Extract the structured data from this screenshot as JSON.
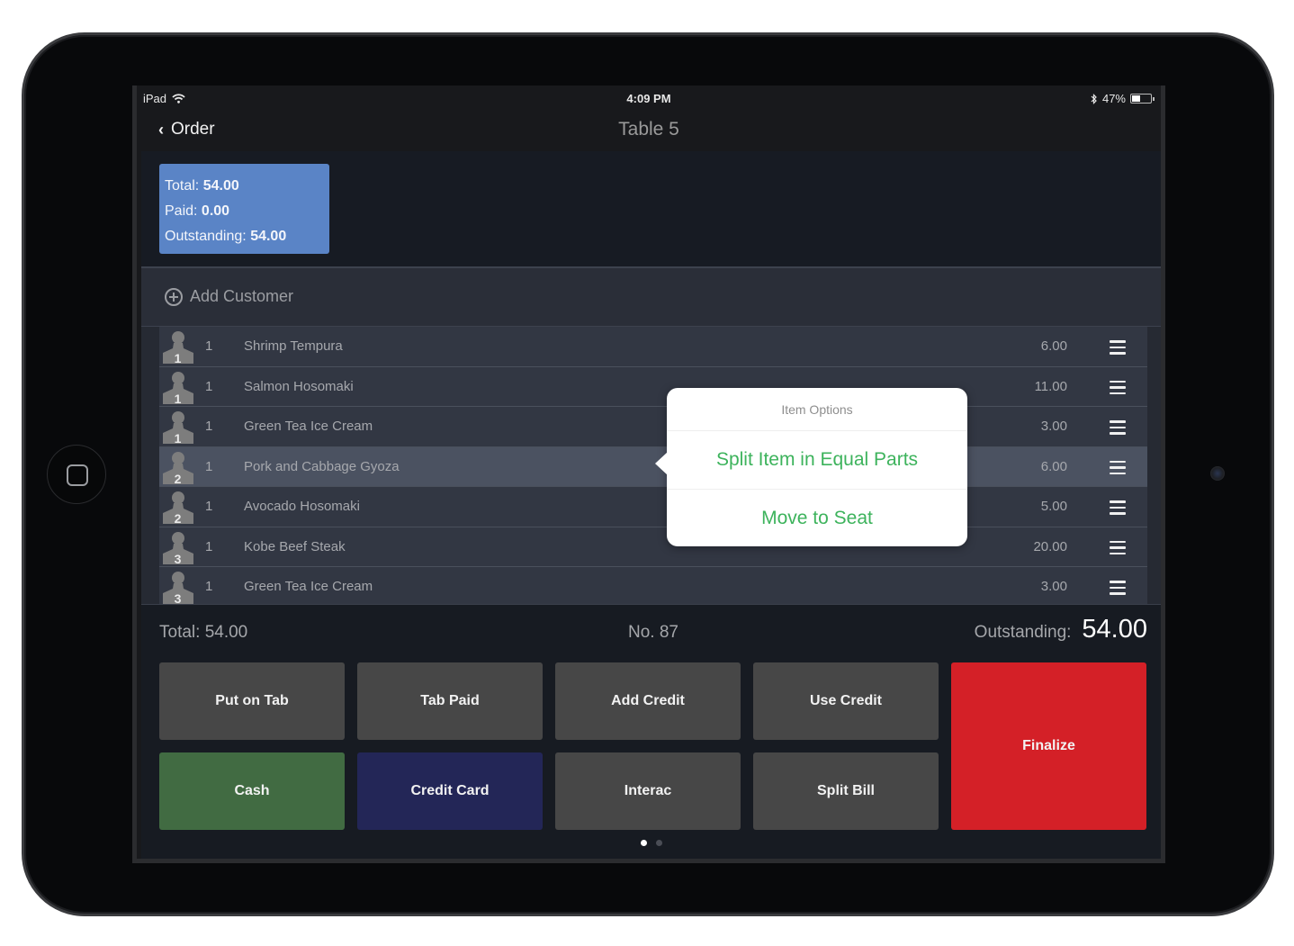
{
  "status_bar": {
    "device": "iPad",
    "time": "4:09 PM",
    "battery_percent": "47%",
    "battery_level": 0.47
  },
  "nav": {
    "back_label": "Order",
    "title": "Table 5"
  },
  "summary": {
    "total_label": "Total:",
    "total_value": "54.00",
    "paid_label": "Paid:",
    "paid_value": "0.00",
    "outstanding_label": "Outstanding:",
    "outstanding_value": "54.00",
    "color": "#5a84c6"
  },
  "add_customer_label": "Add Customer",
  "items": [
    {
      "seat": "1",
      "qty": "1",
      "name": "Shrimp Tempura",
      "price": "6.00"
    },
    {
      "seat": "1",
      "qty": "1",
      "name": "Salmon Hosomaki",
      "price": "11.00"
    },
    {
      "seat": "1",
      "qty": "1",
      "name": "Green Tea Ice Cream",
      "price": "3.00"
    },
    {
      "seat": "2",
      "qty": "1",
      "name": "Pork and Cabbage Gyoza",
      "price": "6.00",
      "selected": true
    },
    {
      "seat": "2",
      "qty": "1",
      "name": "Avocado Hosomaki",
      "price": "5.00"
    },
    {
      "seat": "3",
      "qty": "1",
      "name": "Kobe Beef Steak",
      "price": "20.00"
    },
    {
      "seat": "3",
      "qty": "1",
      "name": "Green Tea Ice Cream",
      "price": "3.00"
    }
  ],
  "popover": {
    "title": "Item Options",
    "options": [
      "Split Item in Equal Parts",
      "Move to Seat"
    ],
    "accent": "#3db35c"
  },
  "totals": {
    "total": "Total: 54.00",
    "order_number": "No. 87",
    "outstanding_label": "Outstanding:",
    "outstanding_value": "54.00"
  },
  "actions": [
    {
      "label": "Put on Tab",
      "color": "#474747"
    },
    {
      "label": "Tab Paid",
      "color": "#474747"
    },
    {
      "label": "Add Credit",
      "color": "#474747"
    },
    {
      "label": "Use Credit",
      "color": "#474747"
    },
    {
      "label": "Cash",
      "color": "#416b42"
    },
    {
      "label": "Credit Card",
      "color": "#232657"
    },
    {
      "label": "Interac",
      "color": "#474747"
    },
    {
      "label": "Split Bill",
      "color": "#474747"
    },
    {
      "label": "Finalize",
      "color": "#d42027"
    }
  ],
  "pagination": {
    "current_page": 1,
    "total_pages": 2
  }
}
